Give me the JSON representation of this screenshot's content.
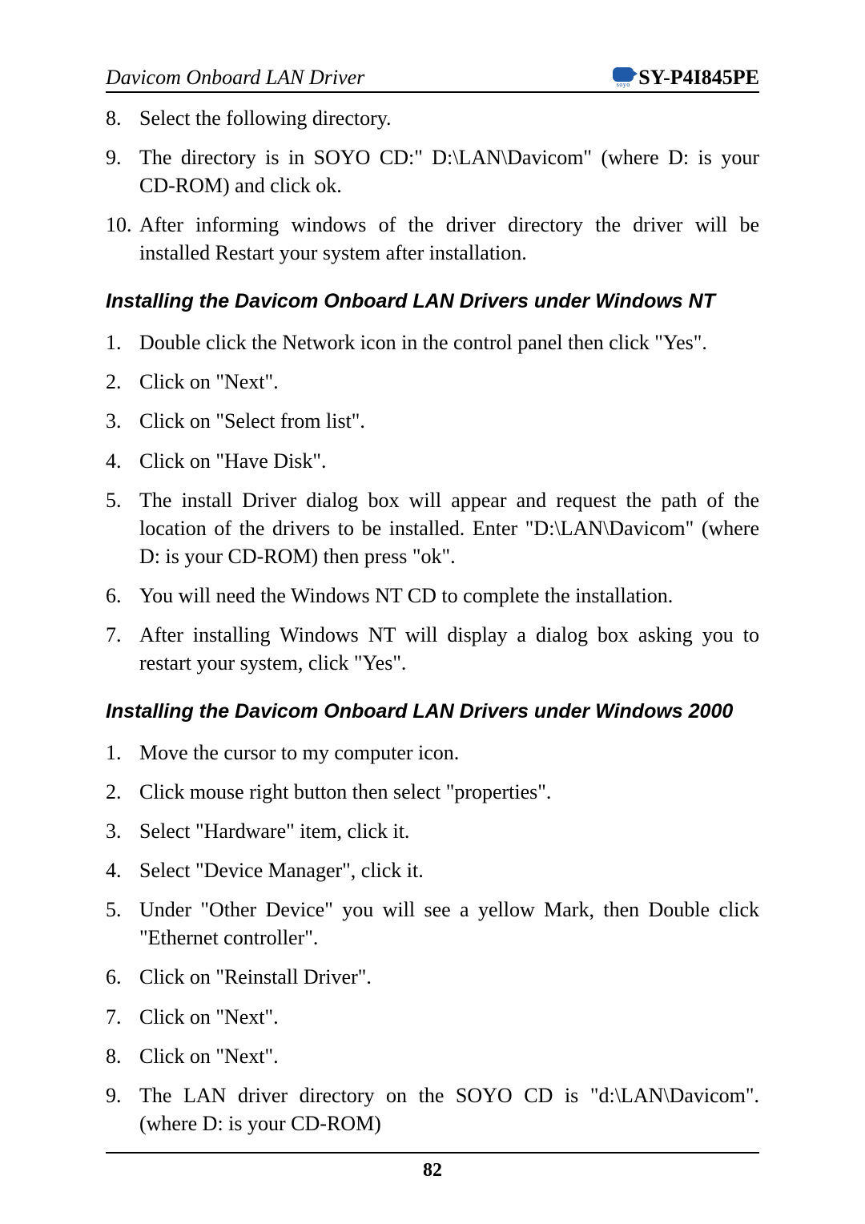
{
  "header": {
    "left": "Davicom Onboard LAN Driver",
    "right": "SY-P4I845PE",
    "logo_text": "soyo"
  },
  "top_list": [
    {
      "n": "8.",
      "t": "Select the following directory."
    },
    {
      "n": "9.",
      "t": "The directory is in SOYO CD:\" D:\\LAN\\Davicom\" (where D: is your CD-ROM) and click ok."
    },
    {
      "n": "10.",
      "t": "After informing windows of the driver directory the driver will be installed Restart your system after installation."
    }
  ],
  "section_nt": "Installing the Davicom Onboard LAN Drivers under Windows NT",
  "nt_list": [
    {
      "n": "1.",
      "t": "Double click the Network icon in the control panel then click \"Yes\"."
    },
    {
      "n": "2.",
      "t": "Click on \"Next\"."
    },
    {
      "n": "3.",
      "t": "Click on \"Select from list\"."
    },
    {
      "n": "4.",
      "t": "Click on \"Have Disk\"."
    },
    {
      "n": "5.",
      "t": "The install Driver dialog box will appear and request the path of the location of the drivers to be installed. Enter \"D:\\LAN\\Davicom\" (where D: is your CD-ROM) then press \"ok\"."
    },
    {
      "n": "6.",
      "t": "You will need the Windows NT CD to complete the installation."
    },
    {
      "n": "7.",
      "t": "After installing Windows NT will display a dialog box asking you to restart your system, click \"Yes\"."
    }
  ],
  "section_2000": "Installing the Davicom Onboard LAN Drivers under Windows 2000",
  "w2000_list": [
    {
      "n": "1.",
      "t": "Move the cursor to my computer icon."
    },
    {
      "n": "2.",
      "t": "Click mouse right button then select \"properties\"."
    },
    {
      "n": "3.",
      "t": "Select \"Hardware\" item, click it."
    },
    {
      "n": "4.",
      "t": "Select \"Device Manager\", click it."
    },
    {
      "n": "5.",
      "t": "Under \"Other Device\" you will see a yellow Mark, then Double click \"Ethernet controller\"."
    },
    {
      "n": "6.",
      "t": "Click on \"Reinstall Driver\"."
    },
    {
      "n": "7.",
      "t": "Click on \"Next\"."
    },
    {
      "n": "8.",
      "t": "Click on \"Next\"."
    },
    {
      "n": "9.",
      "t": "The LAN driver directory on the SOYO CD is \"d:\\LAN\\Davicom\". (where D: is your CD-ROM)"
    }
  ],
  "page_number": "82"
}
